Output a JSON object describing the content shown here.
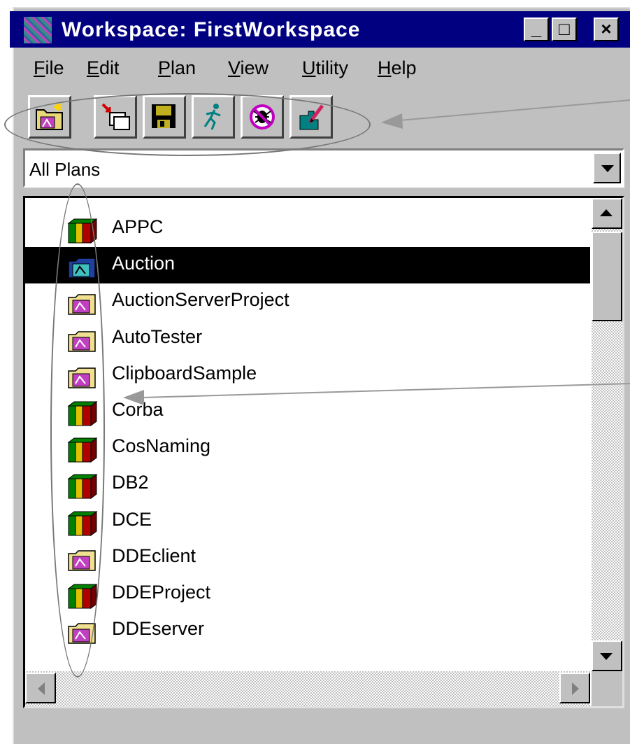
{
  "window": {
    "title": "Workspace: FirstWorkspace",
    "controls": {
      "minimize": "_",
      "maximize": "□",
      "close": "×"
    }
  },
  "menu": [
    {
      "key": "F",
      "rest": "ile"
    },
    {
      "key": "E",
      "rest": "dit"
    },
    {
      "key": "P",
      "rest": "lan"
    },
    {
      "key": "V",
      "rest": "iew"
    },
    {
      "key": "U",
      "rest": "tility"
    },
    {
      "key": "H",
      "rest": "elp"
    }
  ],
  "toolbar": {
    "buttons": [
      "new-plan-icon",
      "load-icon",
      "save-icon",
      "run-icon",
      "debug-icon",
      "edit-plan-icon"
    ]
  },
  "filter": {
    "selected": "All Plans"
  },
  "plans": [
    {
      "name": "APPC",
      "icon": "books-icon",
      "selected": false
    },
    {
      "name": "Auction",
      "icon": "plan-folder-icon",
      "selected": true
    },
    {
      "name": "AuctionServerProject",
      "icon": "plan-folder-icon",
      "selected": false
    },
    {
      "name": "AutoTester",
      "icon": "plan-folder-icon",
      "selected": false
    },
    {
      "name": "ClipboardSample",
      "icon": "plan-folder-icon",
      "selected": false
    },
    {
      "name": "Corba",
      "icon": "books-icon",
      "selected": false
    },
    {
      "name": "CosNaming",
      "icon": "books-icon",
      "selected": false
    },
    {
      "name": "DB2",
      "icon": "books-icon",
      "selected": false
    },
    {
      "name": "DCE",
      "icon": "books-icon",
      "selected": false
    },
    {
      "name": "DDEclient",
      "icon": "plan-folder-icon",
      "selected": false
    },
    {
      "name": "DDEProject",
      "icon": "books-icon",
      "selected": false
    },
    {
      "name": "DDEserver",
      "icon": "plan-folder-icon",
      "selected": false
    }
  ],
  "colors": {
    "titlebar": "#000080",
    "face": "#c0c0c0",
    "selection": "#000000",
    "annotation": "#777777"
  }
}
